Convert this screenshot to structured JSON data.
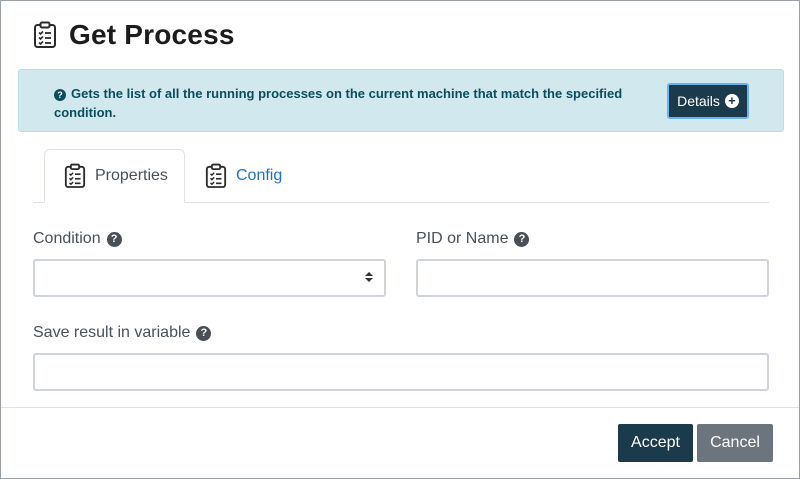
{
  "dialog": {
    "title": "Get Process",
    "title_icon": "clipboard-list-icon"
  },
  "alert": {
    "text": "Gets the list of all the running processes on the current machine that match the specified condition.",
    "details_label": "Details"
  },
  "tabs": [
    {
      "label": "Properties",
      "icon": "clipboard-list-icon",
      "active": true
    },
    {
      "label": "Config",
      "icon": "clipboard-list-icon",
      "active": false
    }
  ],
  "form": {
    "condition_label": "Condition",
    "condition_value": "",
    "pid_label": "PID or Name",
    "pid_value": "",
    "save_label": "Save result in variable",
    "save_value": ""
  },
  "footer": {
    "accept_label": "Accept",
    "cancel_label": "Cancel"
  },
  "colors": {
    "primary": "#1b3a4b",
    "secondary": "#6c757d",
    "info_bg": "#d1e9ee",
    "info_text": "#0c4d5c",
    "link": "#1a73c8"
  }
}
